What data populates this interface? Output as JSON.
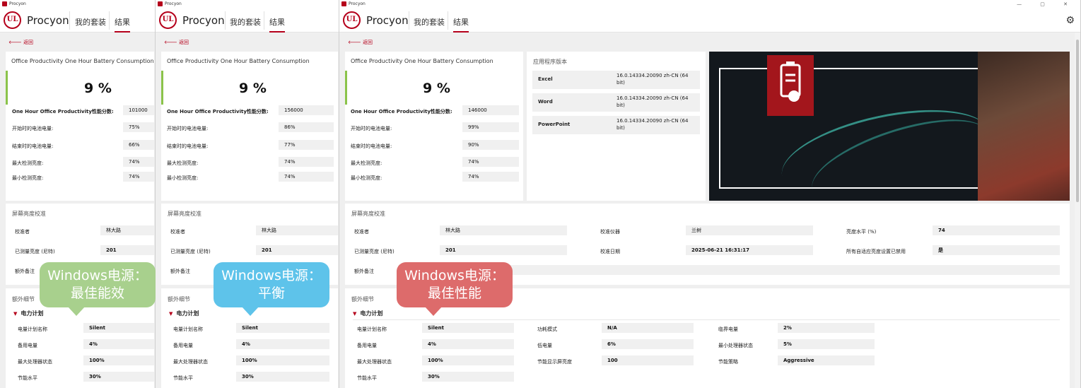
{
  "app": {
    "title": "Procyon",
    "brand": "Procyon",
    "logo_text": "UL",
    "window_controls": "— ▢ ✕"
  },
  "nav": {
    "suites": "我的套装",
    "results": "结果",
    "back": "返回"
  },
  "windows": [
    {
      "test_title": "Office Productivity One Hour Battery Consumption",
      "big_value": "9 %",
      "rows": [
        {
          "label": "One Hour Office Productivity性能分数:",
          "value": "101000"
        },
        {
          "label": "开始时的电池电量:",
          "value": "75%"
        },
        {
          "label": "结束时的电池电量:",
          "value": "66%"
        },
        {
          "label": "最大检测亮度:",
          "value": "74%"
        },
        {
          "label": "最小检测亮度:",
          "value": "74%"
        }
      ],
      "calibration": {
        "title": "屏幕亮度校准",
        "calibrator_label": "校准者",
        "calibrator_value": "林大路",
        "measured_label": "已测量亮度 (尼特)",
        "measured_value": "201",
        "notes_label": "额外备注"
      },
      "details": {
        "title": "额外细节",
        "plan_header": "电力计划",
        "rows": [
          {
            "label": "电量计划名称",
            "value": "Silent"
          },
          {
            "label": "备用电量",
            "value": "4%"
          },
          {
            "label": "最大处理器状态",
            "value": "100%"
          },
          {
            "label": "节能水平",
            "value": "30%"
          }
        ]
      },
      "bubble": {
        "line1": "Windows电源：",
        "line2": "最佳能效"
      }
    },
    {
      "test_title": "Office Productivity One Hour Battery Consumption",
      "big_value": "9 %",
      "rows": [
        {
          "label": "One Hour Office Productivity性能分数:",
          "value": "156000"
        },
        {
          "label": "开始时的电池电量:",
          "value": "86%"
        },
        {
          "label": "结束时的电池电量:",
          "value": "77%"
        },
        {
          "label": "最大检测亮度:",
          "value": "74%"
        },
        {
          "label": "最小检测亮度:",
          "value": "74%"
        }
      ],
      "calibration": {
        "title": "屏幕亮度校准",
        "calibrator_label": "校准者",
        "calibrator_value": "林大路",
        "measured_label": "已测量亮度 (尼特)",
        "measured_value": "201",
        "notes_label": "额外备注"
      },
      "details": {
        "title": "额外细节",
        "plan_header": "电力计划",
        "rows": [
          {
            "label": "电量计划名称",
            "value": "Silent"
          },
          {
            "label": "备用电量",
            "value": "4%"
          },
          {
            "label": "最大处理器状态",
            "value": "100%"
          },
          {
            "label": "节能水平",
            "value": "30%"
          }
        ]
      },
      "bubble": {
        "line1": "Windows电源：",
        "line2": "平衡"
      }
    },
    {
      "test_title": "Office Productivity One Hour Battery Consumption",
      "big_value": "9 %",
      "rows": [
        {
          "label": "One Hour Office Productivity性能分数:",
          "value": "146000"
        },
        {
          "label": "开始时的电池电量:",
          "value": "99%"
        },
        {
          "label": "结束时的电池电量:",
          "value": "90%"
        },
        {
          "label": "最大检测亮度:",
          "value": "74%"
        },
        {
          "label": "最小检测亮度:",
          "value": "74%"
        }
      ],
      "app_versions": {
        "title": "应用程序版本",
        "items": [
          {
            "name": "Excel",
            "version": "16.0.14334.20090 zh-CN (64 bit)"
          },
          {
            "name": "Word",
            "version": "16.0.14334.20090 zh-CN (64 bit)"
          },
          {
            "name": "PowerPoint",
            "version": "16.0.14334.20090 zh-CN (64 bit)"
          }
        ]
      },
      "calibration": {
        "title": "屏幕亮度校准",
        "calibrator_label": "校准者",
        "calibrator_value": "林大路",
        "measured_label": "已测量亮度 (尼特)",
        "measured_value": "201",
        "notes_label": "额外备注",
        "instrument_label": "校准仪器",
        "instrument_value": "兰树",
        "date_label": "校准日期",
        "date_value": "2025-06-21 16:31:17",
        "level_label": "亮度水平 (%)",
        "level_value": "74",
        "adaptive_label": "所有自适应亮度设置已禁用",
        "adaptive_value": "是"
      },
      "details": {
        "title": "额外细节",
        "plan_header": "电力计划",
        "rows": [
          {
            "label": "电量计划名称",
            "value": "Silent"
          },
          {
            "label": "备用电量",
            "value": "4%"
          },
          {
            "label": "最大处理器状态",
            "value": "100%"
          },
          {
            "label": "节能水平",
            "value": "30%"
          }
        ],
        "col2": [
          {
            "label": "功耗模式",
            "value": "N/A"
          },
          {
            "label": "低电量",
            "value": "6%"
          },
          {
            "label": "节能显示屏亮度",
            "value": "100"
          }
        ],
        "col3": [
          {
            "label": "临界电量",
            "value": "2%"
          },
          {
            "label": "最小处理器状态",
            "value": "5%"
          },
          {
            "label": "节能策略",
            "value": "Aggressive"
          }
        ]
      },
      "bubble": {
        "line1": "Windows电源：",
        "line2": "最佳性能"
      }
    }
  ],
  "colors": {
    "brand": "#b5001b",
    "accent_green": "#8bc34a",
    "bubble_green": "#a8d08d",
    "bubble_blue": "#5ec3ea",
    "bubble_red": "#dd6b6b"
  },
  "icons": [
    "ul-logo-icon",
    "back-arrow-icon",
    "chevron-down-icon",
    "gear-icon",
    "battery-clipboard-icon"
  ]
}
